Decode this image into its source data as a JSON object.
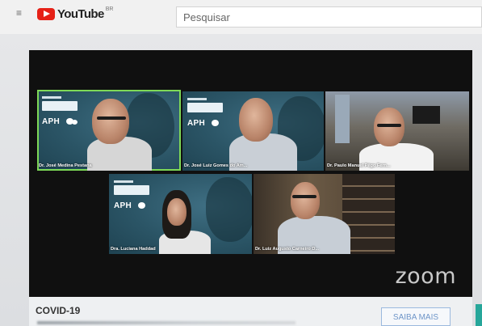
{
  "youtube": {
    "brand": "YouTube",
    "region": "BR",
    "search_placeholder": "Pesquisar"
  },
  "video": {
    "watermark": "zoom",
    "participants": [
      {
        "name": "Dr. José Medina Pestana",
        "active_speaker": true
      },
      {
        "name": "Dr. José Luiz Gomes do Am..."
      },
      {
        "name": "Dr. Paulo Manuel Pêgo Fern..."
      },
      {
        "name": "Dra. Luciana Haddad"
      },
      {
        "name": "Dr. Luiz Augusto Carneiro D..."
      }
    ],
    "overlay_brand": "APH"
  },
  "info": {
    "topic_label": "COVID-19",
    "cta_label": "SAIBA MAIS"
  },
  "colors": {
    "active_speaker_border": "#7ed957",
    "youtube_red": "#e62117",
    "cta_text": "#6e95c8"
  }
}
